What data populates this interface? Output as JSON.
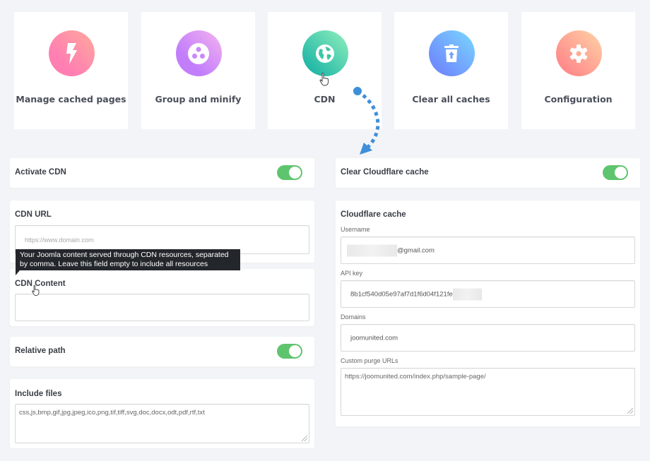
{
  "tiles": [
    {
      "label": "Manage cached pages",
      "icon": "lightning-icon"
    },
    {
      "label": "Group and minify",
      "icon": "group-dots-icon"
    },
    {
      "label": "CDN",
      "icon": "globe-icon"
    },
    {
      "label": "Clear all caches",
      "icon": "trash-icon"
    },
    {
      "label": "Configuration",
      "icon": "gear-icon"
    }
  ],
  "left": {
    "activate_cdn": {
      "label": "Activate CDN",
      "enabled": true
    },
    "cdn_url": {
      "label": "CDN URL",
      "placeholder": "https://www.domain.com",
      "value": ""
    },
    "tooltip": "Your Joomla content served through CDN resources, separated by comma. Leave this field empty to include all resources",
    "cdn_content": {
      "label": "CDN Content",
      "value": ""
    },
    "relative_path": {
      "label": "Relative path",
      "enabled": true
    },
    "include_files": {
      "label": "Include files",
      "value": "css,js,bmp,gif,jpg,jpeg,ico,png,tif,tiff,svg,doc,docx,odt,pdf,rtf,txt"
    }
  },
  "right": {
    "clear_cloudflare": {
      "label": "Clear Cloudflare cache",
      "enabled": true
    },
    "cloudflare": {
      "title": "Cloudflare cache",
      "username_label": "Username",
      "username_value": "@gmail.com",
      "api_key_label": "API key",
      "api_key_value": "8b1cf540d05e97af7d1f6d04f121fe",
      "domains_label": "Domains",
      "domains_value": "joomunited.com",
      "purge_label": "Custom purge URLs",
      "purge_value": "https://joomunited.com/index.php/sample-page/"
    }
  },
  "colors": {
    "toggle_on": "#5fc46e",
    "arrow": "#3d8fd9",
    "tooltip_bg": "#23272b"
  }
}
